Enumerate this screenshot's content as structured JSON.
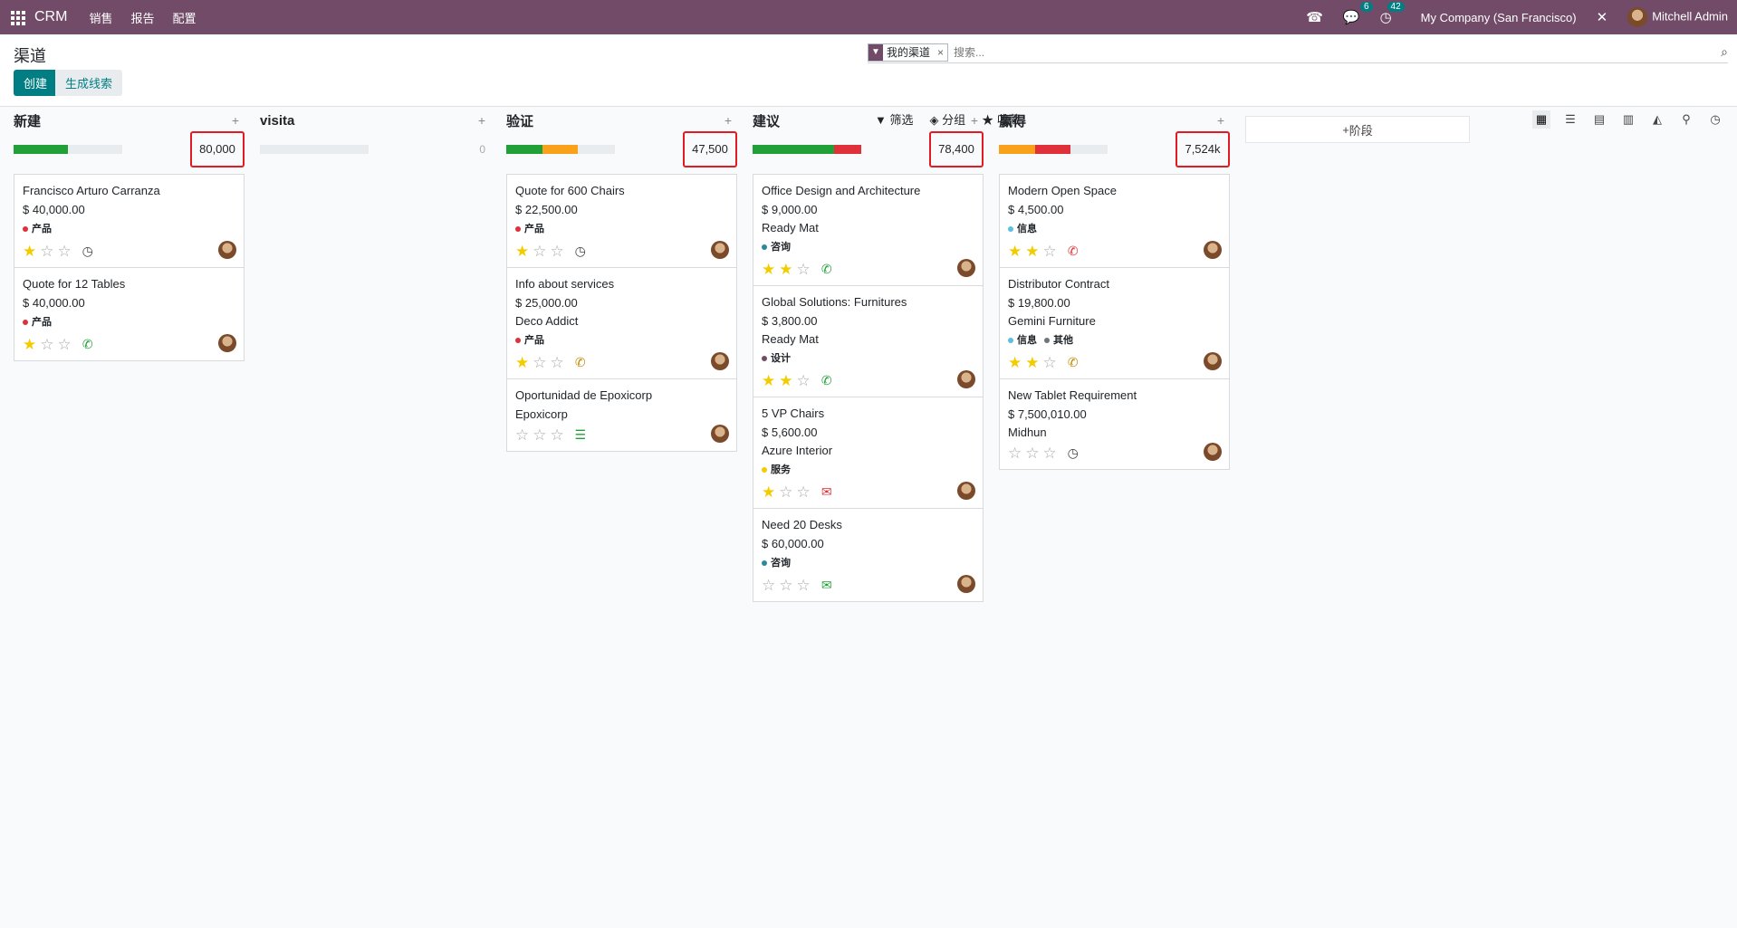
{
  "navbar": {
    "brand": "CRM",
    "menus": [
      "销售",
      "报告",
      "配置"
    ],
    "messages_count": "6",
    "activities_count": "42",
    "company": "My Company (San Francisco)",
    "user": "Mitchell Admin"
  },
  "page": {
    "title": "渠道",
    "create_label": "创建",
    "generate_label": "生成线索"
  },
  "search": {
    "facet": "我的渠道",
    "placeholder": "搜索..."
  },
  "filters": {
    "filter": "筛选",
    "group": "分组",
    "favorites": "收藏"
  },
  "stage_add_label": "阶段",
  "colors": {
    "primary": "#714b67",
    "accent": "#017e84",
    "green": "#21a038",
    "orange": "#f9a11b",
    "red": "#e0303a",
    "grey": "#e9ecef"
  },
  "columns": [
    {
      "title": "新建",
      "sum": "80,000",
      "highlight": true,
      "progress": [
        {
          "color": "#21a038",
          "pct": 0.5
        }
      ],
      "cards": [
        {
          "name": "Francisco Arturo Carranza",
          "amount": "$ 40,000.00",
          "company": "",
          "tags": [
            {
              "label": "产品",
              "color": "#e0303a"
            }
          ],
          "stars": 1,
          "activity": "clock-icon",
          "activity_color": "#444"
        },
        {
          "name": "Quote for 12 Tables",
          "amount": "$ 40,000.00",
          "company": "",
          "tags": [
            {
              "label": "产品",
              "color": "#e0303a"
            }
          ],
          "stars": 1,
          "activity": "phone-icon",
          "activity_color": "#21a038"
        }
      ]
    },
    {
      "title": "visita",
      "sum": "0",
      "highlight": false,
      "progress": [],
      "cards": []
    },
    {
      "title": "验证",
      "sum": "47,500",
      "highlight": true,
      "progress": [
        {
          "color": "#21a038",
          "pct": 0.33
        },
        {
          "color": "#f9a11b",
          "pct": 0.33
        }
      ],
      "cards": [
        {
          "name": "Quote for 600 Chairs",
          "amount": "$ 22,500.00",
          "company": "",
          "tags": [
            {
              "label": "产品",
              "color": "#e0303a"
            }
          ],
          "stars": 1,
          "activity": "clock-icon",
          "activity_color": "#444"
        },
        {
          "name": "Info about services",
          "amount": "$ 25,000.00",
          "company": "Deco Addict",
          "tags": [
            {
              "label": "产品",
              "color": "#e0303a"
            }
          ],
          "stars": 1,
          "activity": "phone-icon",
          "activity_color": "#c08a00"
        },
        {
          "name": "Oportunidad de Epoxicorp",
          "amount": "",
          "company": "Epoxicorp",
          "tags": [],
          "stars": 0,
          "activity": "task-icon",
          "activity_color": "#21a038"
        }
      ]
    },
    {
      "title": "建议",
      "sum": "78,400",
      "highlight": true,
      "progress": [
        {
          "color": "#21a038",
          "pct": 0.75
        },
        {
          "color": "#e0303a",
          "pct": 0.25
        }
      ],
      "cards": [
        {
          "name": "Office Design and Architecture",
          "amount": "$ 9,000.00",
          "company": "Ready Mat",
          "tags": [
            {
              "label": "咨询",
              "color": "#2a8a9a"
            }
          ],
          "stars": 2,
          "activity": "phone-icon",
          "activity_color": "#21a038"
        },
        {
          "name": "Global Solutions: Furnitures",
          "amount": "$ 3,800.00",
          "company": "Ready Mat",
          "tags": [
            {
              "label": "设计",
              "color": "#714b67"
            }
          ],
          "stars": 2,
          "activity": "phone-icon",
          "activity_color": "#21a038"
        },
        {
          "name": "5 VP Chairs",
          "amount": "$ 5,600.00",
          "company": "Azure Interior",
          "tags": [
            {
              "label": "服务",
              "color": "#f3cc00"
            }
          ],
          "stars": 1,
          "activity": "envelope-icon",
          "activity_color": "#e0303a"
        },
        {
          "name": "Need 20 Desks",
          "amount": "$ 60,000.00",
          "company": "",
          "tags": [
            {
              "label": "咨询",
              "color": "#2a8a9a"
            }
          ],
          "stars": 0,
          "activity": "envelope-icon",
          "activity_color": "#21a038"
        }
      ]
    },
    {
      "title": "赢得",
      "sum": "7,524k",
      "highlight": true,
      "progress": [
        {
          "color": "#f9a11b",
          "pct": 0.33
        },
        {
          "color": "#e0303a",
          "pct": 0.33
        }
      ],
      "cards": [
        {
          "name": "Modern Open Space",
          "amount": "$ 4,500.00",
          "company": "",
          "tags": [
            {
              "label": "信息",
              "color": "#5bc0de"
            }
          ],
          "stars": 2,
          "activity": "phone-icon",
          "activity_color": "#e0303a"
        },
        {
          "name": "Distributor Contract",
          "amount": "$ 19,800.00",
          "company": "Gemini Furniture",
          "tags": [
            {
              "label": "信息",
              "color": "#5bc0de"
            },
            {
              "label": "其他",
              "color": "#6c757d"
            }
          ],
          "stars": 2,
          "activity": "phone-icon",
          "activity_color": "#c08a00"
        },
        {
          "name": "New Tablet Requirement",
          "amount": "$ 7,500,010.00",
          "company": "Midhun",
          "tags": [],
          "stars": 0,
          "activity": "clock-icon",
          "activity_color": "#444"
        }
      ]
    }
  ]
}
